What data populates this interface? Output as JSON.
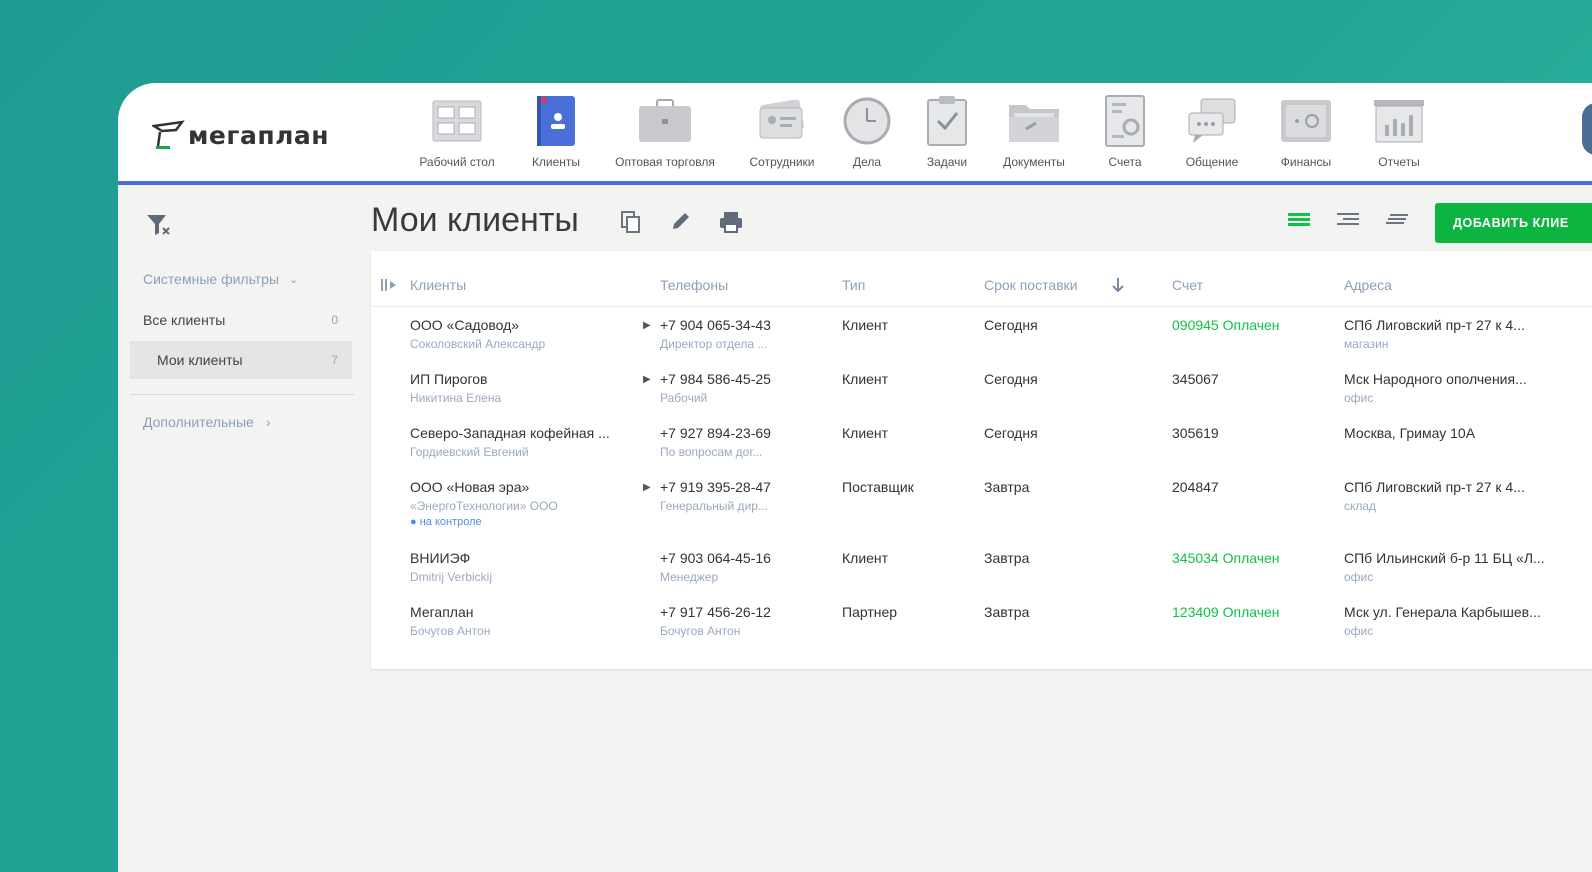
{
  "app": {
    "logo_text": "мегаплан"
  },
  "nav": [
    {
      "label": "Рабочий стол",
      "icon": "dashboard-icon"
    },
    {
      "label": "Клиенты",
      "icon": "clients-icon"
    },
    {
      "label": "Оптовая торговля",
      "icon": "briefcase-icon"
    },
    {
      "label": "Сотрудники",
      "icon": "employees-icon"
    },
    {
      "label": "Дела",
      "icon": "clock-icon"
    },
    {
      "label": "Задачи",
      "icon": "tasks-icon"
    },
    {
      "label": "Документы",
      "icon": "folder-icon"
    },
    {
      "label": "Счета",
      "icon": "invoice-icon"
    },
    {
      "label": "Общение",
      "icon": "chat-icon"
    },
    {
      "label": "Финансы",
      "icon": "safe-icon"
    },
    {
      "label": "Отчеты",
      "icon": "reports-icon"
    }
  ],
  "active_nav": "Клиенты",
  "sidebar": {
    "system_filters": "Системные фильтры",
    "items": [
      {
        "label": "Все клиенты",
        "count": "0"
      },
      {
        "label": "Мои клиенты",
        "count": "7"
      }
    ],
    "extra": "Дополнительные"
  },
  "page": {
    "title": "Мои клиенты",
    "add_button": "ДОБАВИТЬ КЛИЕ"
  },
  "table": {
    "columns": [
      "Клиенты",
      "Телефоны",
      "Тип",
      "Срок поставки",
      "Счет",
      "Адреса"
    ],
    "rows": [
      {
        "name": "ООО «Садовод»",
        "contact": "Соколовский Александр",
        "tag": "",
        "has_arrow": true,
        "phone": "+7 904 065-34-43",
        "phone_note": "Директор отдела ...",
        "type": "Клиент",
        "delivery": "Сегодня",
        "invoice": "090945 Оплачен",
        "paid": true,
        "address": "СПб Лиговский пр-т 27 к 4...",
        "address_note": "магазин"
      },
      {
        "name": "ИП Пирогов",
        "contact": "Никитина Елена",
        "tag": "",
        "has_arrow": true,
        "phone": "+7 984 586-45-25",
        "phone_note": "Рабочий",
        "type": "Клиент",
        "delivery": "Сегодня",
        "invoice": "345067",
        "paid": false,
        "address": "Мск Народного ополчения...",
        "address_note": "офис"
      },
      {
        "name": "Северо-Западная кофейная ...",
        "contact": "Гордиевский Евгений",
        "tag": "",
        "has_arrow": false,
        "phone": "+7 927 894-23-69",
        "phone_note": "По вопросам дог...",
        "type": "Клиент",
        "delivery": "Сегодня",
        "invoice": "305619",
        "paid": false,
        "address": "Москва, Гримау 10А",
        "address_note": ""
      },
      {
        "name": "ООО «Новая эра»",
        "contact": "«ЭнергоТехнологии» ООО",
        "tag": "● на контроле",
        "has_arrow": true,
        "phone": "+7 919 395-28-47",
        "phone_note": "Генеральный дир...",
        "type": "Поставщик",
        "delivery": "Завтра",
        "invoice": "204847",
        "paid": false,
        "address": "СПб Лиговский пр-т 27 к 4...",
        "address_note": "склад"
      },
      {
        "name": "ВНИИЭФ",
        "contact": "Dmitrij Verbickij",
        "tag": "",
        "has_arrow": false,
        "phone": "+7 903 064-45-16",
        "phone_note": "Менеджер",
        "type": "Клиент",
        "delivery": "Завтра",
        "invoice": "345034 Оплачен",
        "paid": true,
        "address": "СПб Ильинский б-р 11 БЦ «Л...",
        "address_note": "офис"
      },
      {
        "name": "Мегаплан",
        "contact": "Бочугов Антон",
        "tag": "",
        "has_arrow": false,
        "phone": "+7 917 456-26-12",
        "phone_note": "Бочугов Антон",
        "type": "Партнер",
        "delivery": "Завтра",
        "invoice": "123409 Оплачен",
        "paid": true,
        "address": "Мск ул. Генерала Карбышев...",
        "address_note": "офис"
      }
    ]
  },
  "colors": {
    "accent": "#4a6fd6",
    "button": "#0db43f",
    "paid": "#11c24a",
    "background": "#23a596"
  }
}
